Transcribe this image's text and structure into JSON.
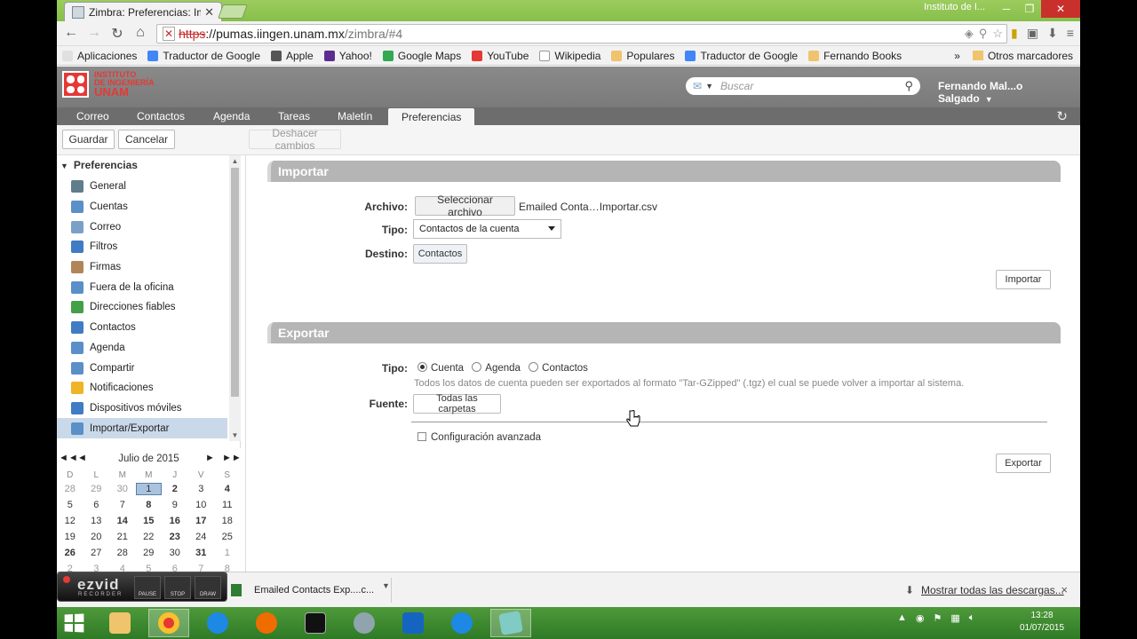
{
  "browser": {
    "tab_title": "Zimbra: Preferencias: Importar/Exportar",
    "window_label": "Instituto de I...",
    "url_scheme": "https",
    "url_host": "://pumas.iingen.unam.mx",
    "url_path": "/zimbra/#4"
  },
  "bookmarks": [
    {
      "label": "Aplicaciones",
      "color": "#e0e0e0"
    },
    {
      "label": "Traductor de Google",
      "color": "#4285f4"
    },
    {
      "label": "Apple",
      "color": "#555555"
    },
    {
      "label": "Yahoo!",
      "color": "#5c2d91"
    },
    {
      "label": "Google Maps",
      "color": "#34a853"
    },
    {
      "label": "YouTube",
      "color": "#e53935"
    },
    {
      "label": "Wikipedia",
      "color": "#ffffff"
    },
    {
      "label": "Populares",
      "color": "#f0c36d"
    },
    {
      "label": "Traductor de Google",
      "color": "#4285f4"
    },
    {
      "label": "Fernando Books",
      "color": "#f0c36d"
    }
  ],
  "bookmarks_more": "»",
  "bookmarks_other": "Otros marcadores",
  "header": {
    "logo_line1": "INSTITUTO",
    "logo_line2": "DE INGENIERÍA",
    "logo_line3": "UNAM",
    "search_placeholder": "Buscar",
    "user": "Fernando Mal...o Salgado"
  },
  "app_tabs": [
    "Correo",
    "Contactos",
    "Agenda",
    "Tareas",
    "Maletín",
    "Preferencias"
  ],
  "actions": {
    "save": "Guardar",
    "cancel": "Cancelar",
    "undo": "Deshacer cambios"
  },
  "sidebar": {
    "heading": "Preferencias",
    "items": [
      {
        "label": "General",
        "color": "#607d8b"
      },
      {
        "label": "Cuentas",
        "color": "#5b8fc7"
      },
      {
        "label": "Correo",
        "color": "#7aa0c8"
      },
      {
        "label": "Filtros",
        "color": "#3f7cc4"
      },
      {
        "label": "Firmas",
        "color": "#b0855a"
      },
      {
        "label": "Fuera de la oficina",
        "color": "#5b8fc7"
      },
      {
        "label": "Direcciones fiables",
        "color": "#43a047"
      },
      {
        "label": "Contactos",
        "color": "#3f7cc4"
      },
      {
        "label": "Agenda",
        "color": "#5b8fc7"
      },
      {
        "label": "Compartir",
        "color": "#5b8fc7"
      },
      {
        "label": "Notificaciones",
        "color": "#f0b429"
      },
      {
        "label": "Dispositivos móviles",
        "color": "#3f7cc4"
      },
      {
        "label": "Importar/Exportar",
        "color": "#5b8fc7"
      }
    ],
    "selected_index": 12
  },
  "calendar": {
    "title": "Julio de 2015",
    "nav_prev_year": "◄◄",
    "nav_prev": "◄",
    "nav_next": "►",
    "nav_next_year": "►►",
    "dow": [
      "D",
      "L",
      "M",
      "M",
      "J",
      "V",
      "S"
    ],
    "weeks": [
      [
        "28",
        "29",
        "30",
        "1",
        "2",
        "3",
        "4"
      ],
      [
        "5",
        "6",
        "7",
        "8",
        "9",
        "10",
        "11"
      ],
      [
        "12",
        "13",
        "14",
        "15",
        "16",
        "17",
        "18"
      ],
      [
        "19",
        "20",
        "21",
        "22",
        "23",
        "24",
        "25"
      ],
      [
        "26",
        "27",
        "28",
        "29",
        "30",
        "31",
        "1"
      ],
      [
        "2",
        "3",
        "4",
        "5",
        "6",
        "7",
        "8"
      ]
    ]
  },
  "import": {
    "title": "Importar",
    "file_label": "Archivo:",
    "choose_file": "Seleccionar archivo",
    "file_name": "Emailed Conta…Importar.csv",
    "type_label": "Tipo:",
    "type_value": "Contactos de la cuenta",
    "dest_label": "Destino:",
    "dest_value": "Contactos",
    "import_button": "Importar"
  },
  "export": {
    "title": "Exportar",
    "type_label": "Tipo:",
    "options": [
      "Cuenta",
      "Agenda",
      "Contactos"
    ],
    "selected": "Cuenta",
    "hint": "Todos los datos de cuenta pueden ser exportados al formato \"Tar-GZipped\" (.tgz) el cual se puede volver a importar al sistema.",
    "source_label": "Fuente:",
    "source_value": "Todas las carpetas",
    "advanced": "Configuración avanzada",
    "export_button": "Exportar"
  },
  "ezvid": {
    "logo": "ezvid",
    "sub": "RECORDER",
    "pause": "PAUSE",
    "stop": "STOP",
    "draw": "DRAW"
  },
  "downloads": {
    "item": "Emailed Contacts Exp....c...",
    "show_all": "Mostrar todas las descargas...",
    "close": "×"
  },
  "taskbar": {
    "time": "13:28",
    "date": "01/07/2015"
  }
}
